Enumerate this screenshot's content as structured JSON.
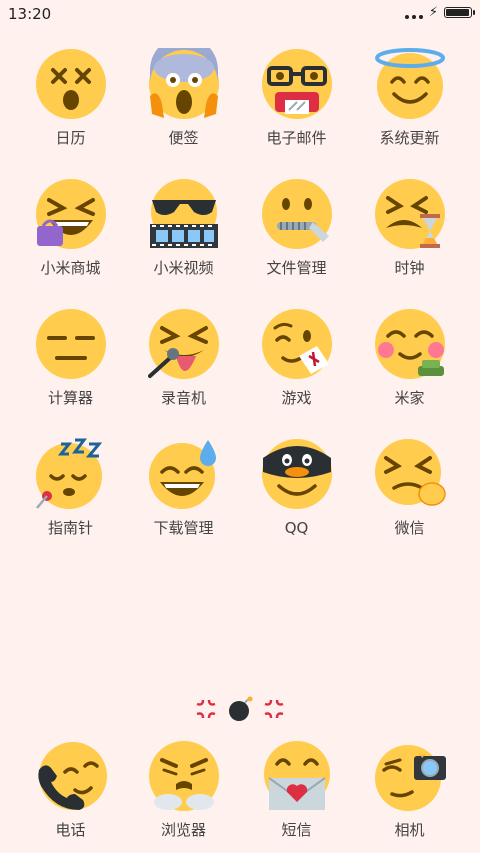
{
  "status": {
    "time": "13:20",
    "battery_level": 0.95
  },
  "colors": {
    "background": "#fff1ee",
    "emoji_yellow": "#ffcc4d",
    "emoji_feature": "#664500"
  },
  "apps": [
    {
      "label": "日历",
      "icon": "dizzy-face-icon"
    },
    {
      "label": "便签",
      "icon": "screaming-face-icon"
    },
    {
      "label": "电子邮件",
      "icon": "nerd-face-icon"
    },
    {
      "label": "系统更新",
      "icon": "halo-face-icon"
    },
    {
      "label": "小米商城",
      "icon": "laughing-face-icon"
    },
    {
      "label": "小米视频",
      "icon": "sunglasses-face-icon"
    },
    {
      "label": "文件管理",
      "icon": "zipper-mouth-face-icon"
    },
    {
      "label": "时钟",
      "icon": "tired-face-icon"
    },
    {
      "label": "计算器",
      "icon": "expressionless-face-icon"
    },
    {
      "label": "录音机",
      "icon": "tongue-face-icon"
    },
    {
      "label": "游戏",
      "icon": "winking-face-icon"
    },
    {
      "label": "米家",
      "icon": "blushing-face-icon"
    },
    {
      "label": "指南针",
      "icon": "sleeping-face-icon"
    },
    {
      "label": "下载管理",
      "icon": "sweat-smile-face-icon"
    },
    {
      "label": "QQ",
      "icon": "penguin-face-icon"
    },
    {
      "label": "微信",
      "icon": "persevering-face-icon"
    }
  ],
  "dock": [
    {
      "label": "电话",
      "icon": "phone-face-icon"
    },
    {
      "label": "浏览器",
      "icon": "steam-face-icon"
    },
    {
      "label": "短信",
      "icon": "love-letter-face-icon"
    },
    {
      "label": "相机",
      "icon": "camera-face-icon"
    }
  ]
}
